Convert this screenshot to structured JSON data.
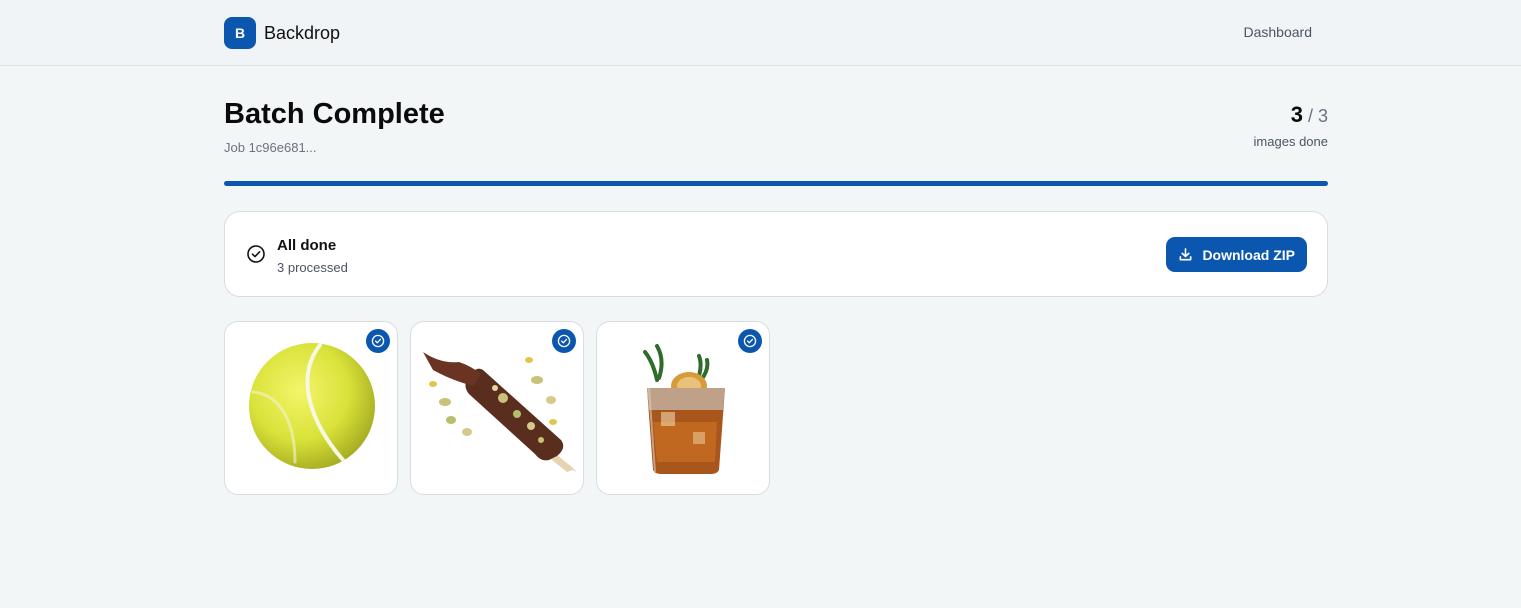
{
  "header": {
    "logo_letter": "B",
    "app_name": "Backdrop",
    "nav_dashboard": "Dashboard"
  },
  "page": {
    "title": "Batch Complete",
    "job_id": "Job 1c96e681..."
  },
  "counter": {
    "done": "3",
    "separator_total": " / 3",
    "label": "images done"
  },
  "progress": {
    "fraction": 1.0
  },
  "status": {
    "icon": "check-circle-icon",
    "title": "All done",
    "subtitle": "3 processed",
    "download_label": "Download ZIP",
    "download_icon": "download-icon"
  },
  "thumbnails": [
    {
      "subject": "tennis-ball",
      "status_icon": "check-circle-icon"
    },
    {
      "subject": "chocolate-ice-cream-bar",
      "status_icon": "check-circle-icon"
    },
    {
      "subject": "cocktail-glass",
      "status_icon": "check-circle-icon"
    }
  ],
  "colors": {
    "accent": "#0b57b0",
    "background": "#f2f6f7",
    "header_bg": "#f1f4f6"
  }
}
